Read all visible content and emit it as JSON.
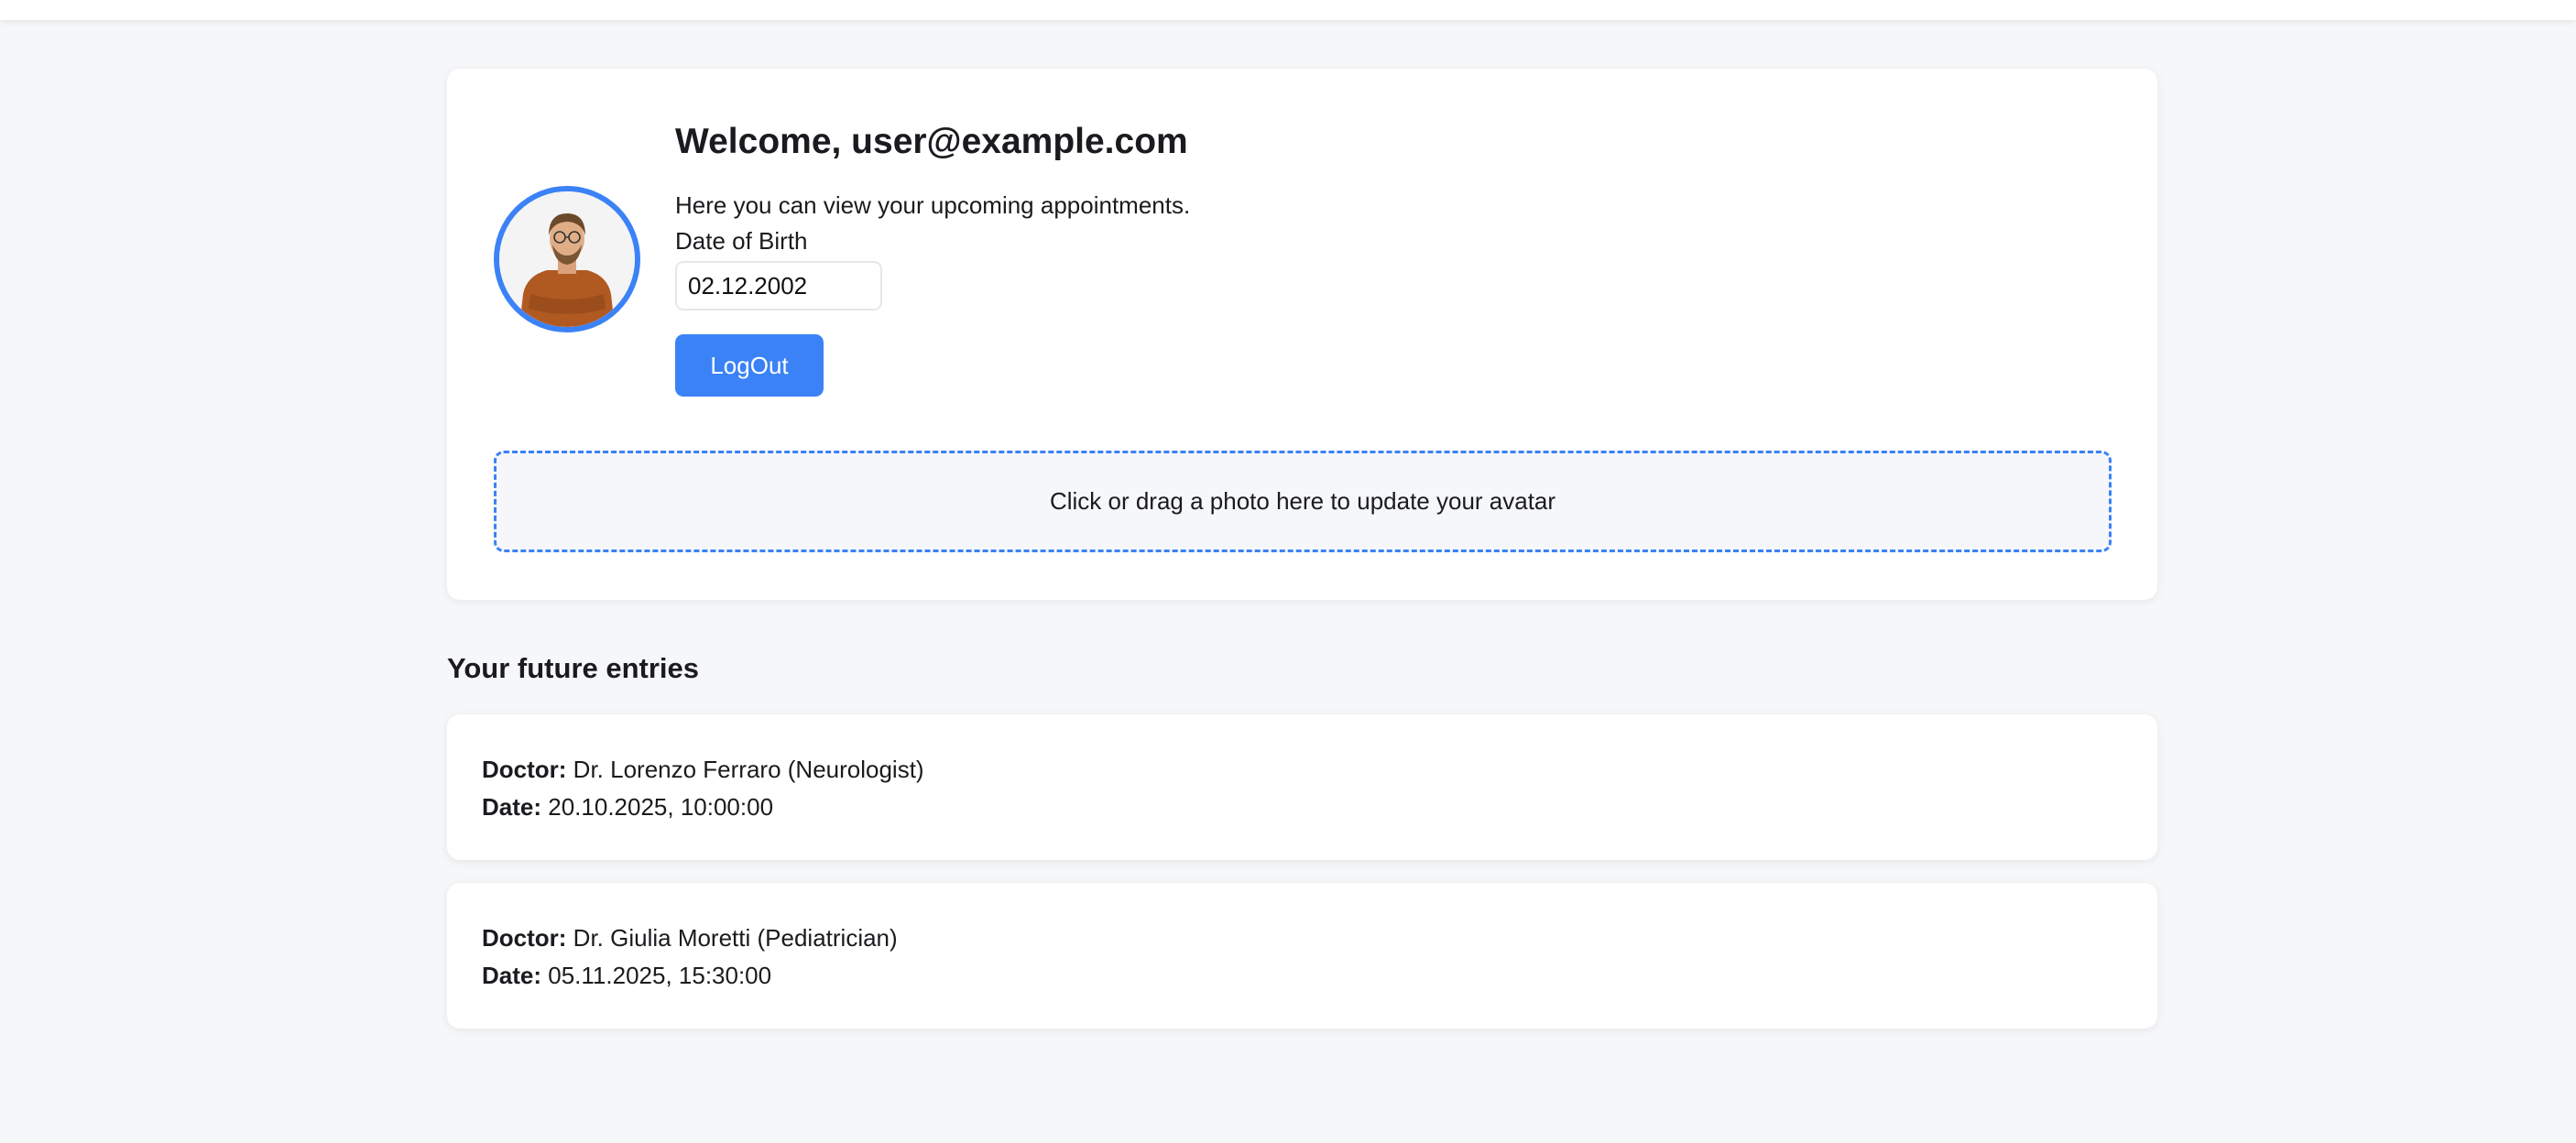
{
  "profile": {
    "welcome": "Welcome, user@example.com",
    "subtitle": "Here you can view your upcoming appointments.",
    "dob_label": "Date of Birth",
    "dob_value": "02.12.2002",
    "logout_label": "LogOut",
    "dropzone_text": "Click or drag a photo here to update your avatar"
  },
  "entries_section": {
    "title": "Your future entries",
    "doctor_key": "Doctor:",
    "date_key": "Date:",
    "items": [
      {
        "doctor": "Dr. Lorenzo Ferraro (Neurologist)",
        "date": "20.10.2025, 10:00:00"
      },
      {
        "doctor": "Dr. Giulia Moretti (Pediatrician)",
        "date": "05.11.2025, 15:30:00"
      }
    ]
  },
  "colors": {
    "accent": "#3b82f6",
    "background": "#f6f7f9",
    "card": "#ffffff"
  },
  "icons": {
    "avatar": "user-photo"
  }
}
